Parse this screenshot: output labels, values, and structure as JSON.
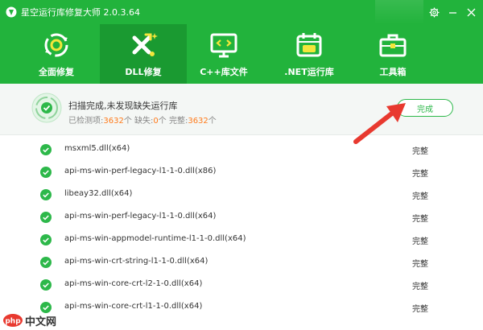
{
  "app": {
    "title": "星空运行库修复大师 2.0.3.64"
  },
  "tabs": [
    {
      "label": "全面修复",
      "icon": "recycle-repair-icon",
      "active": false
    },
    {
      "label": "DLL修复",
      "icon": "dll-tools-icon",
      "active": true
    },
    {
      "label": "C++库文件",
      "icon": "code-monitor-icon",
      "active": false
    },
    {
      "label": ".NET运行库",
      "icon": "net-calendar-icon",
      "active": false
    },
    {
      "label": "工具箱",
      "icon": "toolbox-icon",
      "active": false
    }
  ],
  "status": {
    "title": "扫描完成,未发现缺失运行库",
    "checked_label": "已检测项:",
    "checked_value": "3632",
    "checked_unit": "个",
    "missing_label": "缺失:",
    "missing_value": "0",
    "missing_unit": "个",
    "complete_label": "完整:",
    "complete_value": "3632",
    "complete_unit": "个",
    "done_button": "完成"
  },
  "list": [
    {
      "name": "msxml5.dll(x64)",
      "status": "完整"
    },
    {
      "name": "api-ms-win-perf-legacy-l1-1-0.dll(x86)",
      "status": "完整"
    },
    {
      "name": "libeay32.dll(x64)",
      "status": "完整"
    },
    {
      "name": "api-ms-win-perf-legacy-l1-1-0.dll(x64)",
      "status": "完整"
    },
    {
      "name": "api-ms-win-appmodel-runtime-l1-1-0.dll(x64)",
      "status": "完整"
    },
    {
      "name": "api-ms-win-crt-string-l1-1-0.dll(x64)",
      "status": "完整"
    },
    {
      "name": "api-ms-win-core-crt-l2-1-0.dll(x64)",
      "status": "完整"
    },
    {
      "name": "api-ms-win-core-crt-l1-1-0.dll(x64)",
      "status": "完整"
    }
  ],
  "watermark": {
    "text": "中文网"
  },
  "colors": {
    "brand_green": "#22b33c",
    "active_tab": "#1a9a31",
    "highlight_orange": "#ff7a1a",
    "arrow_red": "#e8392f"
  }
}
